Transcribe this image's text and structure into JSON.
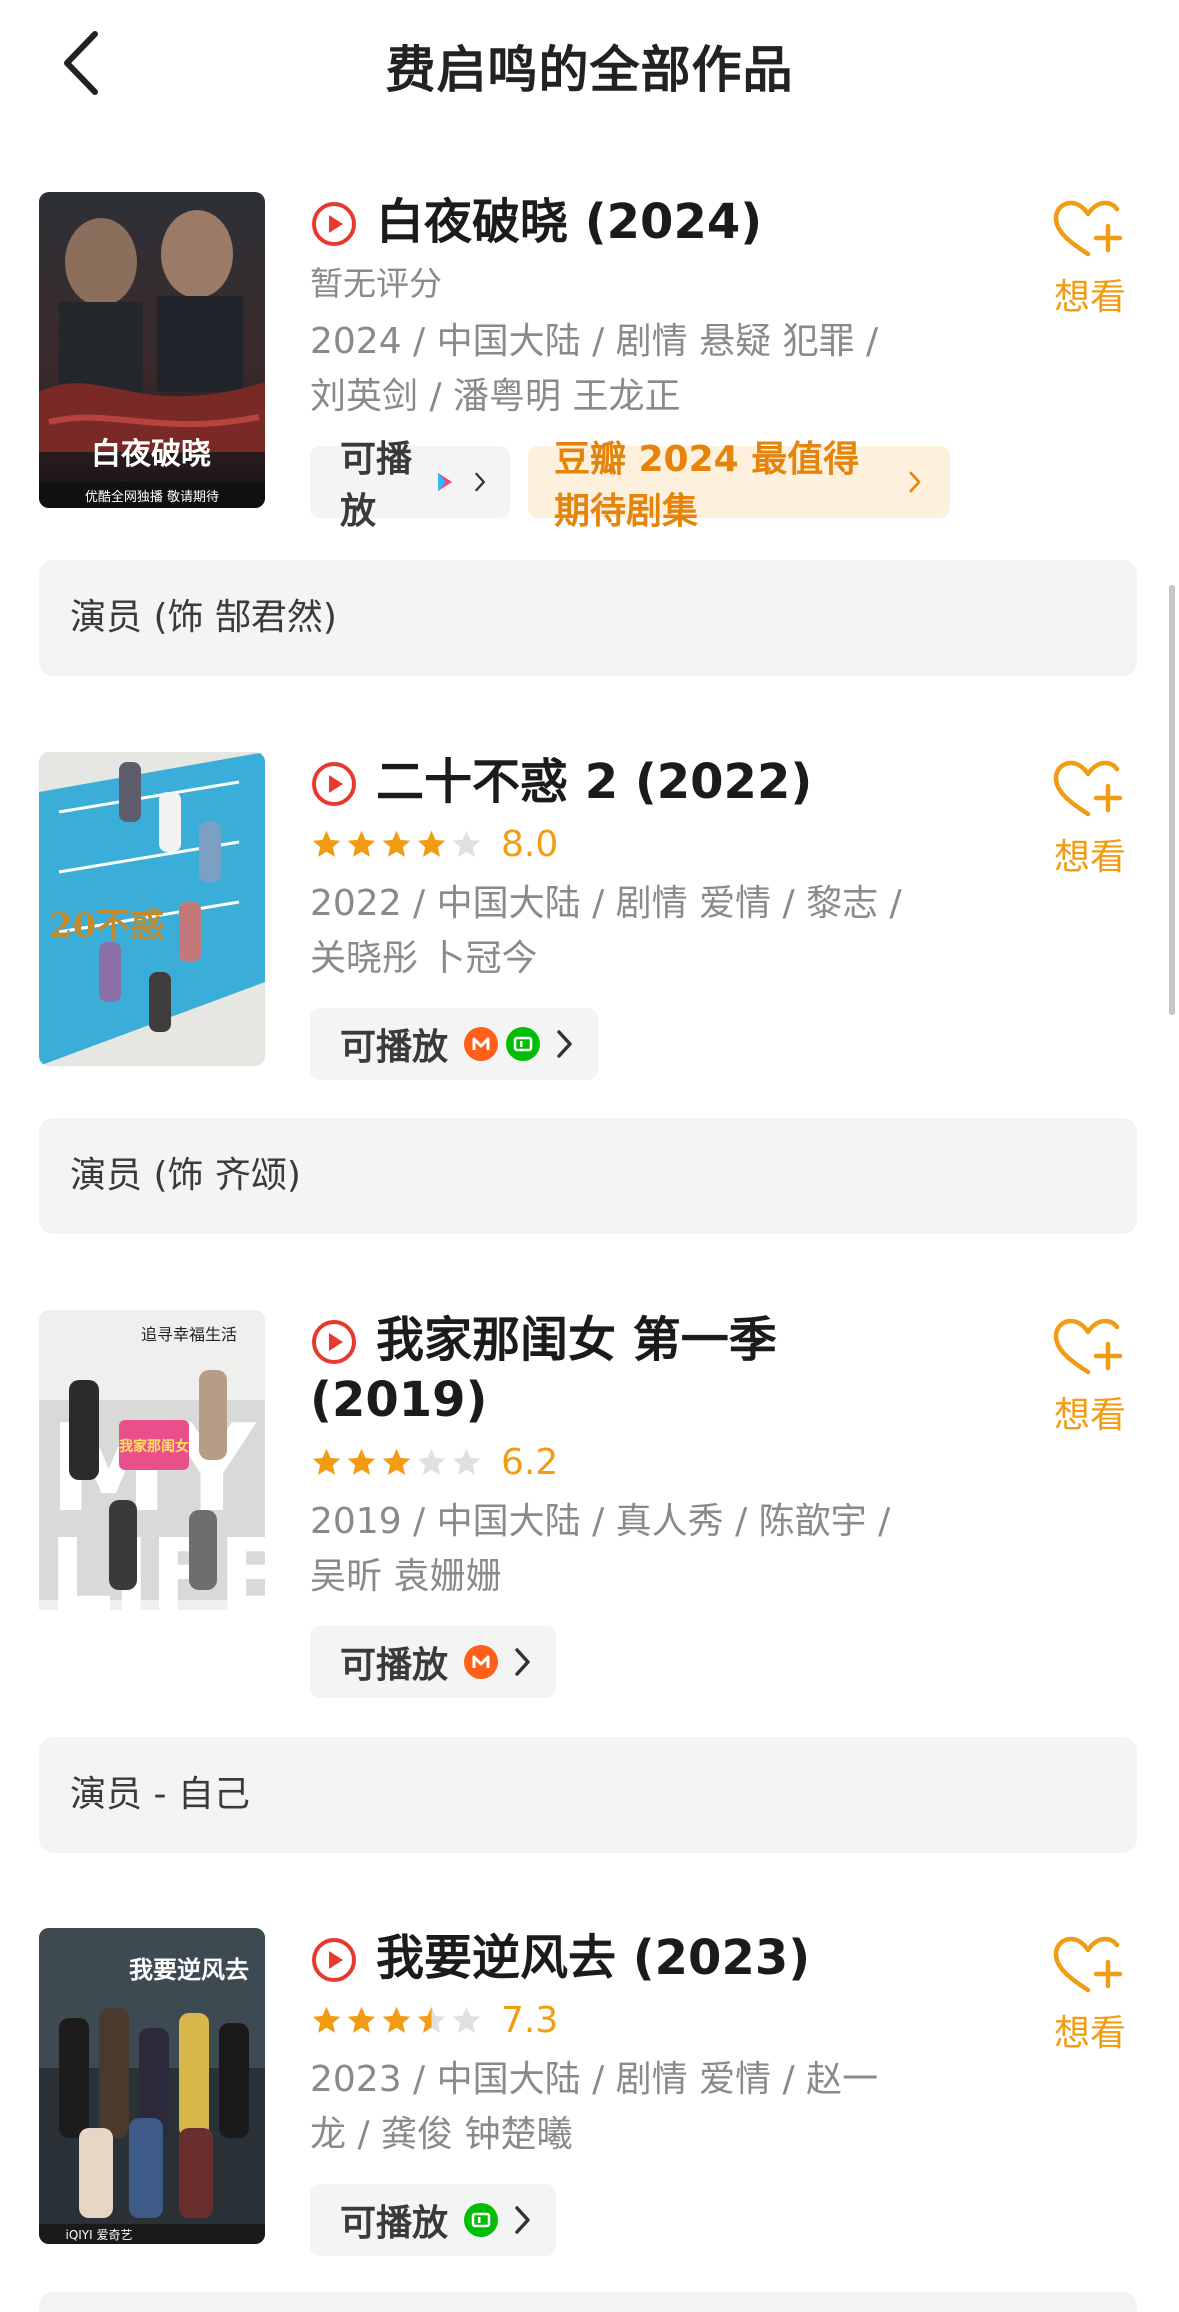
{
  "header": {
    "title": "费启鸣的全部作品"
  },
  "want_label": "想看",
  "play_label": "可播放",
  "items": [
    {
      "title": "白夜破晓 (2024)",
      "no_rating": "暂无评分",
      "meta1": "2024 / 中国大陆 / 剧情 悬疑 犯罪 /",
      "meta2": "刘英剑 / 潘粤明 王龙正",
      "platforms": [
        "youku-icon"
      ],
      "award": "豆瓣 2024 最值得期待剧集",
      "role": "演员 (饰 郜君然)",
      "poster_texts": [
        "白夜破晓",
        "优酷全网独播 敬请期待"
      ]
    },
    {
      "title": "二十不惑 2 (2022)",
      "rating": "8.0",
      "rating_stars": 4,
      "meta1": "2022 / 中国大陆 / 剧情 爱情 / 黎志 /",
      "meta2": "关晓彤 卜冠今",
      "platforms": [
        "mgtv-icon",
        "iqiyi-icon"
      ],
      "role": "演员 (饰 齐颂)",
      "poster_texts": [
        "20不惑"
      ]
    },
    {
      "title_line1": "我家那闺女 第一季",
      "title_line2": "(2019)",
      "rating": "6.2",
      "rating_stars": 3,
      "meta1": "2019 / 中国大陆 / 真人秀 / 陈歆宇 /",
      "meta2": "吴昕 袁姗姗",
      "platforms": [
        "mgtv-icon"
      ],
      "role": "演员 - 自己",
      "poster_texts": [
        "追寻幸福生活",
        "我家那闺女"
      ]
    },
    {
      "title": "我要逆风去 (2023)",
      "rating": "7.3",
      "rating_stars": 3.5,
      "meta1": "2023 / 中国大陆 / 剧情 爱情 / 赵一",
      "meta2": "龙 / 龚俊 钟楚曦",
      "platforms": [
        "iqiyi-icon"
      ],
      "poster_texts": [
        "我要逆风去",
        "iQIYI 爱奇艺"
      ]
    }
  ],
  "colors": {
    "accent": "#f29c14",
    "play_red": "#e8392f",
    "chip_bg": "#f4f4f4",
    "award_bg": "#fdf1de"
  }
}
